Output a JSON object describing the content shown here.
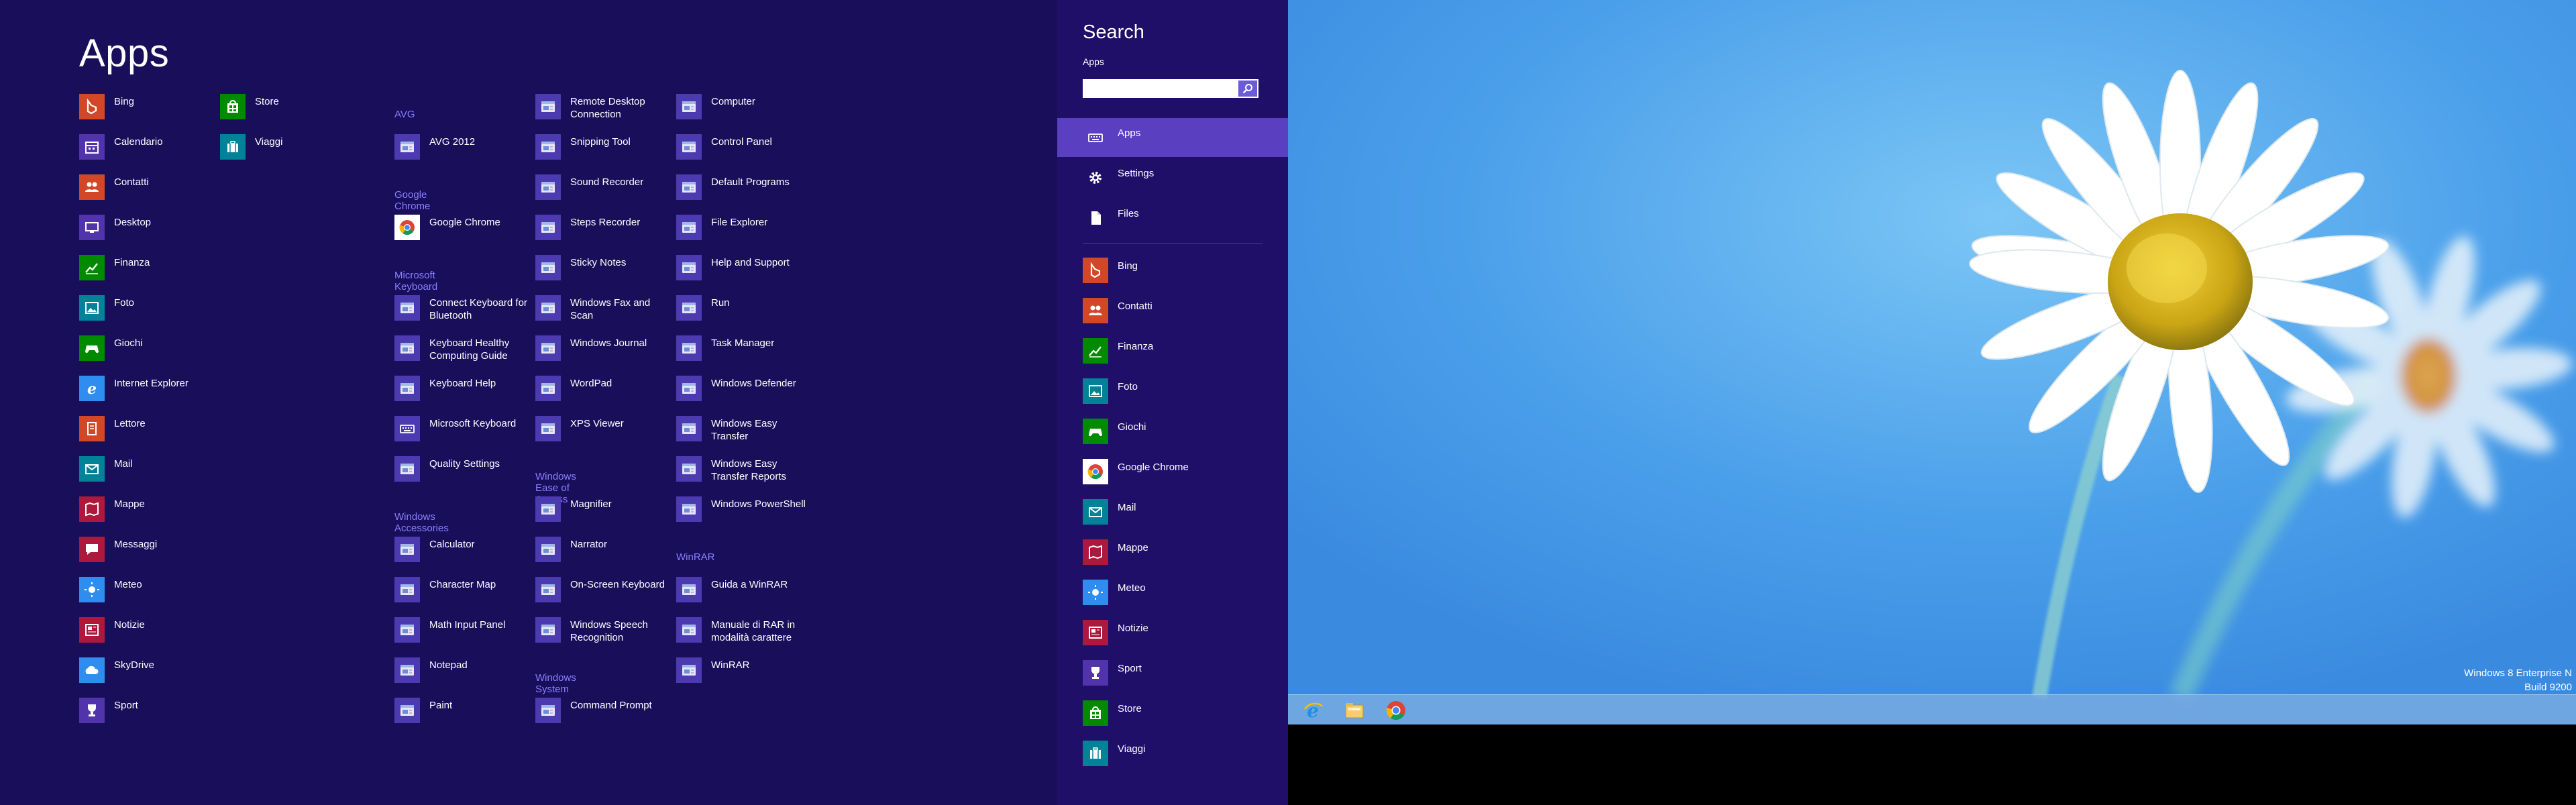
{
  "apps": {
    "title": "Apps",
    "column1": [
      {
        "label": "Bing",
        "icon": "bing-icon",
        "color": "#D24726"
      },
      {
        "label": "Calendario",
        "icon": "calendar-icon",
        "color": "#5133AB"
      },
      {
        "label": "Contatti",
        "icon": "people-icon",
        "color": "#D24726"
      },
      {
        "label": "Desktop",
        "icon": "desktop-icon",
        "color": "#5133AB"
      },
      {
        "label": "Finanza",
        "icon": "finance-icon",
        "color": "#008A00"
      },
      {
        "label": "Foto",
        "icon": "photos-icon",
        "color": "#008299"
      },
      {
        "label": "Giochi",
        "icon": "games-icon",
        "color": "#008A00"
      },
      {
        "label": "Internet Explorer",
        "icon": "internet-explorer-icon",
        "color": "#2E8DEF"
      },
      {
        "label": "Lettore",
        "icon": "reader-icon",
        "color": "#D24726"
      },
      {
        "label": "Mail",
        "icon": "mail-icon",
        "color": "#008299"
      },
      {
        "label": "Mappe",
        "icon": "maps-icon",
        "color": "#AC193D"
      },
      {
        "label": "Messaggi",
        "icon": "messaging-icon",
        "color": "#AC193D"
      },
      {
        "label": "Meteo",
        "icon": "weather-icon",
        "color": "#2E8DEF"
      },
      {
        "label": "Notizie",
        "icon": "news-icon",
        "color": "#AC193D"
      },
      {
        "label": "SkyDrive",
        "icon": "skydrive-icon",
        "color": "#2E8DEF"
      },
      {
        "label": "Sport",
        "icon": "sport-icon",
        "color": "#5133AB"
      }
    ],
    "column2": [
      {
        "label": "Store",
        "icon": "store-icon",
        "color": "#008A00"
      },
      {
        "label": "Viaggi",
        "icon": "travel-icon",
        "color": "#008299"
      }
    ],
    "column3": [
      {
        "type": "group",
        "label": "AVG"
      },
      {
        "label": "AVG 2012",
        "icon": "avg-icon",
        "color": "#4B3AB0"
      },
      {
        "type": "group",
        "label": "Google Chrome"
      },
      {
        "label": "Google Chrome",
        "icon": "chrome-icon",
        "color": "#FFFFFF"
      },
      {
        "type": "group",
        "label": "Microsoft Keyboard"
      },
      {
        "label": "Connect Keyboard for Bluetooth",
        "icon": "bluetooth-icon",
        "color": "#4B3AB0"
      },
      {
        "label": "Keyboard Healthy Computing Guide",
        "icon": "keyboard-guide-icon",
        "color": "#4B3AB0"
      },
      {
        "label": "Keyboard Help",
        "icon": "keyboard-help-icon",
        "color": "#4B3AB0"
      },
      {
        "label": "Microsoft Keyboard",
        "icon": "keyboard-icon",
        "color": "#4B3AB0"
      },
      {
        "label": "Quality Settings",
        "icon": "quality-settings-icon",
        "color": "#4B3AB0"
      },
      {
        "type": "group",
        "label": "Windows Accessories"
      },
      {
        "label": "Calculator",
        "icon": "calculator-icon",
        "color": "#4B3AB0"
      },
      {
        "label": "Character Map",
        "icon": "character-map-icon",
        "color": "#4B3AB0"
      },
      {
        "label": "Math Input Panel",
        "icon": "math-input-icon",
        "color": "#4B3AB0"
      },
      {
        "label": "Notepad",
        "icon": "notepad-icon",
        "color": "#4B3AB0"
      },
      {
        "label": "Paint",
        "icon": "paint-icon",
        "color": "#4B3AB0"
      }
    ],
    "column4": [
      {
        "label": "Remote Desktop Connection",
        "icon": "remote-desktop-icon",
        "color": "#4B3AB0"
      },
      {
        "label": "Snipping Tool",
        "icon": "snipping-tool-icon",
        "color": "#4B3AB0"
      },
      {
        "label": "Sound Recorder",
        "icon": "sound-recorder-icon",
        "color": "#4B3AB0"
      },
      {
        "label": "Steps Recorder",
        "icon": "steps-recorder-icon",
        "color": "#4B3AB0"
      },
      {
        "label": "Sticky Notes",
        "icon": "sticky-notes-icon",
        "color": "#4B3AB0"
      },
      {
        "label": "Windows Fax and Scan",
        "icon": "fax-scan-icon",
        "color": "#4B3AB0"
      },
      {
        "label": "Windows Journal",
        "icon": "journal-icon",
        "color": "#4B3AB0"
      },
      {
        "label": "WordPad",
        "icon": "wordpad-icon",
        "color": "#4B3AB0"
      },
      {
        "label": "XPS Viewer",
        "icon": "xps-viewer-icon",
        "color": "#4B3AB0"
      },
      {
        "type": "group",
        "label": "Windows Ease of Access"
      },
      {
        "label": "Magnifier",
        "icon": "magnifier-icon",
        "color": "#4B3AB0"
      },
      {
        "label": "Narrator",
        "icon": "narrator-icon",
        "color": "#4B3AB0"
      },
      {
        "label": "On-Screen Keyboard",
        "icon": "onscreen-keyboard-icon",
        "color": "#4B3AB0"
      },
      {
        "label": "Windows Speech Recognition",
        "icon": "speech-recognition-icon",
        "color": "#4B3AB0"
      },
      {
        "type": "group",
        "label": "Windows System"
      },
      {
        "label": "Command Prompt",
        "icon": "command-prompt-icon",
        "color": "#4B3AB0"
      }
    ],
    "column5": [
      {
        "label": "Computer",
        "icon": "computer-icon",
        "color": "#4B3AB0"
      },
      {
        "label": "Control Panel",
        "icon": "control-panel-icon",
        "color": "#4B3AB0"
      },
      {
        "label": "Default Programs",
        "icon": "default-programs-icon",
        "color": "#4B3AB0"
      },
      {
        "label": "File Explorer",
        "icon": "file-explorer-icon",
        "color": "#4B3AB0"
      },
      {
        "label": "Help and Support",
        "icon": "help-icon",
        "color": "#4B3AB0"
      },
      {
        "label": "Run",
        "icon": "run-icon",
        "color": "#4B3AB0"
      },
      {
        "label": "Task Manager",
        "icon": "task-manager-icon",
        "color": "#4B3AB0"
      },
      {
        "label": "Windows Defender",
        "icon": "defender-icon",
        "color": "#4B3AB0"
      },
      {
        "label": "Windows Easy Transfer",
        "icon": "easy-transfer-icon",
        "color": "#4B3AB0"
      },
      {
        "label": "Windows Easy Transfer Reports",
        "icon": "easy-transfer-reports-icon",
        "color": "#4B3AB0"
      },
      {
        "label": "Windows PowerShell",
        "icon": "powershell-icon",
        "color": "#4B3AB0"
      },
      {
        "type": "group",
        "label": "WinRAR"
      },
      {
        "label": "Guida a WinRAR",
        "icon": "winrar-help-icon",
        "color": "#4B3AB0"
      },
      {
        "label": "Manuale di RAR in modalità carattere",
        "icon": "rar-manual-icon",
        "color": "#4B3AB0"
      },
      {
        "label": "WinRAR",
        "icon": "winrar-icon",
        "color": "#4B3AB0"
      }
    ]
  },
  "search": {
    "title": "Search",
    "scope": "Apps",
    "input_value": "",
    "placeholder": "",
    "categories": [
      {
        "label": "Apps",
        "icon": "keyboard-icon",
        "selected": true
      },
      {
        "label": "Settings",
        "icon": "settings-gear-icon",
        "selected": false
      },
      {
        "label": "Files",
        "icon": "file-icon",
        "selected": false
      }
    ],
    "apps": [
      {
        "label": "Bing",
        "icon": "bing-icon",
        "color": "#D24726"
      },
      {
        "label": "Contatti",
        "icon": "people-icon",
        "color": "#D24726"
      },
      {
        "label": "Finanza",
        "icon": "finance-icon",
        "color": "#008A00"
      },
      {
        "label": "Foto",
        "icon": "photos-icon",
        "color": "#008299"
      },
      {
        "label": "Giochi",
        "icon": "games-icon",
        "color": "#008A00"
      },
      {
        "label": "Google Chrome",
        "icon": "chrome-icon",
        "color": "#FFFFFF"
      },
      {
        "label": "Mail",
        "icon": "mail-icon",
        "color": "#008299"
      },
      {
        "label": "Mappe",
        "icon": "maps-icon",
        "color": "#AC193D"
      },
      {
        "label": "Meteo",
        "icon": "weather-icon",
        "color": "#2E8DEF"
      },
      {
        "label": "Notizie",
        "icon": "news-icon",
        "color": "#AC193D"
      },
      {
        "label": "Sport",
        "icon": "sport-icon",
        "color": "#5133AB"
      },
      {
        "label": "Store",
        "icon": "store-icon",
        "color": "#008A00"
      },
      {
        "label": "Viaggi",
        "icon": "travel-icon",
        "color": "#008299"
      }
    ]
  },
  "desktop": {
    "taskbar": [
      {
        "name": "internet-explorer",
        "icon": "internet-explorer-icon"
      },
      {
        "name": "file-explorer",
        "icon": "file-explorer-icon"
      },
      {
        "name": "google-chrome",
        "icon": "chrome-icon"
      }
    ],
    "watermark_line1": "Windows 8 Enterprise N",
    "watermark_line2": "Build 9200"
  }
}
